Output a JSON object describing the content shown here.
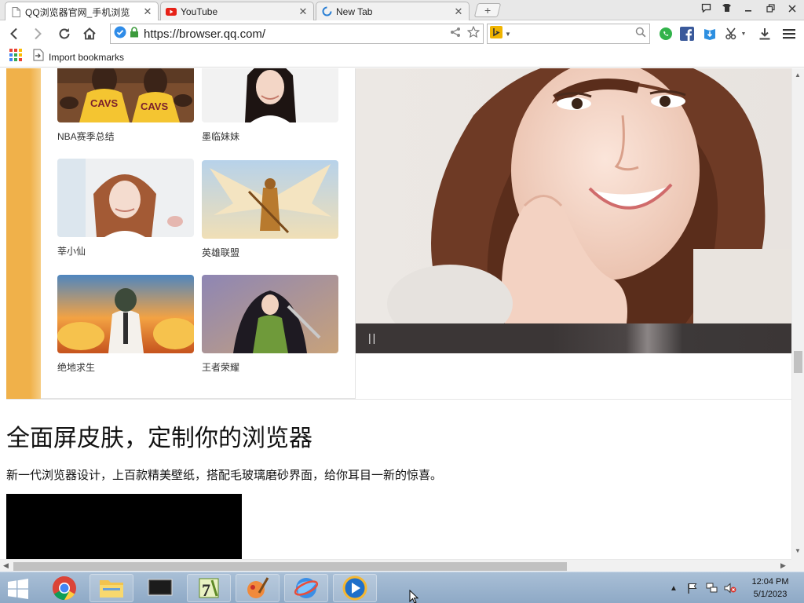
{
  "tabs": [
    {
      "title": "QQ浏览器官网_手机浏览",
      "icon": "page-icon",
      "active": true
    },
    {
      "title": "YouTube",
      "icon": "youtube-icon",
      "active": false
    },
    {
      "title": "New Tab",
      "icon": "loading-icon",
      "active": false
    }
  ],
  "address_bar": {
    "url": "https://browser.qq.com/"
  },
  "bookmarks": {
    "import_label": "Import bookmarks"
  },
  "cards": [
    {
      "caption": "NBA赛季总结"
    },
    {
      "caption": "墨临妹妹"
    },
    {
      "caption": "莘小仙"
    },
    {
      "caption": "英雄联盟"
    },
    {
      "caption": "绝地求生"
    },
    {
      "caption": "王者荣耀"
    }
  ],
  "hero": {
    "pause_symbol": "||"
  },
  "section": {
    "headline": "全面屏皮肤，定制你的浏览器",
    "description": "新一代浏览器设计，上百款精美壁纸，搭配毛玻璃磨砂界面，给你耳目一新的惊喜。"
  },
  "clock": {
    "time": "12:04 PM",
    "date": "5/1/2023"
  },
  "colors": {
    "accent_orange": "#f0b14a",
    "hero_bar": "#3b3636",
    "taskbar": "#9db4cf"
  }
}
